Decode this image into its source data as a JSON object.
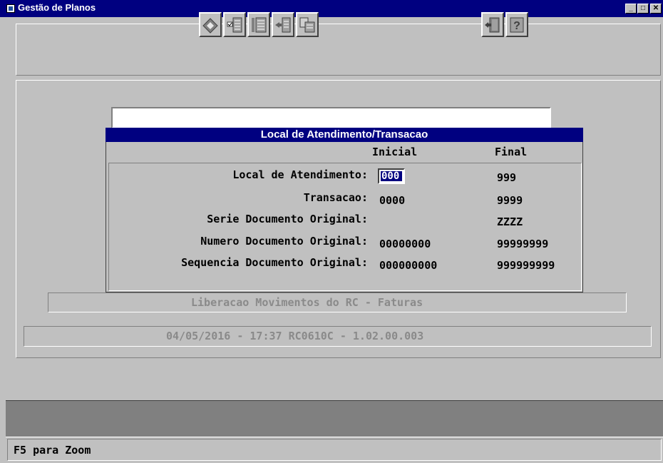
{
  "window": {
    "title": "Gestão de Planos",
    "controls": {
      "minimize": "_",
      "maximize": "□",
      "close": "✕"
    }
  },
  "toolbar": {
    "buttons": [
      {
        "name": "eraser-icon"
      },
      {
        "name": "checklist-icon"
      },
      {
        "name": "ordered-list-icon"
      },
      {
        "name": "import-icon"
      },
      {
        "name": "copy-documents-icon"
      },
      {
        "name": "exit-door-icon"
      },
      {
        "name": "help-icon"
      }
    ]
  },
  "dialog": {
    "title": "Local de Atendimento/Transacao",
    "columns": {
      "initial": "Inicial",
      "final": "Final"
    },
    "rows": [
      {
        "label": "Local de Atendimento:",
        "initial": "000",
        "final": "999"
      },
      {
        "label": "Transacao:",
        "initial": "0000",
        "final": "9999"
      },
      {
        "label": "Serie Documento Original:",
        "initial": "",
        "final": "ZZZZ"
      },
      {
        "label": "Numero Documento Original:",
        "initial": "00000000",
        "final": "99999999"
      },
      {
        "label": "Sequencia Documento Original:",
        "initial": "000000000",
        "final": "999999999"
      }
    ]
  },
  "info": {
    "program_description": "Liberacao Movimentos do RC - Faturas"
  },
  "version": {
    "text": "04/05/2016 - 17:37  RC0610C - 1.02.00.003"
  },
  "status": {
    "text": "F5 para Zoom"
  }
}
